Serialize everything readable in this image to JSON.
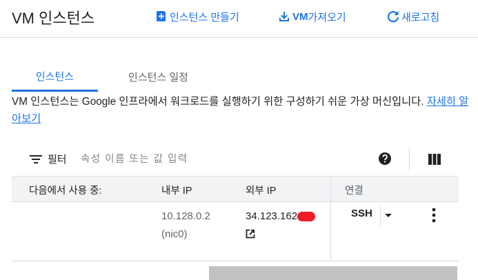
{
  "header": {
    "title": "VM 인스턴스",
    "create_label": "인스턴스 만들기",
    "import_label_bold": "VM",
    "import_label_rest": " 가져오기",
    "refresh_label": "새로고침"
  },
  "tabs": [
    {
      "label": "인스턴스",
      "active": true
    },
    {
      "label": "인스턴스 일정",
      "active": false
    }
  ],
  "description": {
    "text": "VM 인스턴스는 Google 인프라에서 워크로드를 실행하기 위한 구성하기 쉬운 가상 머신입니다. ",
    "link": "자세히 알아보기"
  },
  "filter": {
    "label": "필터",
    "placeholder": "속성 이름 또는 값 입력"
  },
  "table": {
    "headers": {
      "using": "다음에서 사용 중:",
      "internal_ip": "내부 IP",
      "external_ip": "외부 IP",
      "connect": "연결"
    },
    "rows": [
      {
        "using": "",
        "internal_ip": "10.128.0.2",
        "internal_nic": "(nic0)",
        "external_ip": "34.123.162",
        "connect": "SSH"
      }
    ]
  },
  "colors": {
    "accent": "#1a73e8",
    "redaction": "#ee1c25",
    "header_bg": "#f1f3f4"
  }
}
